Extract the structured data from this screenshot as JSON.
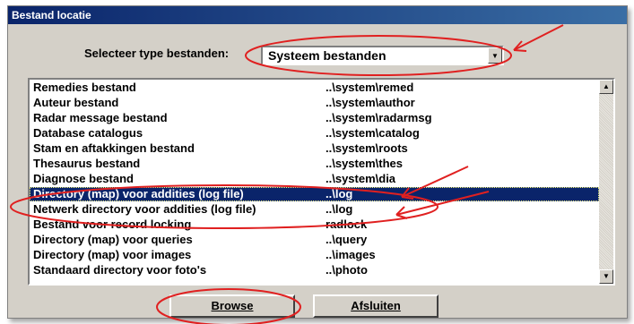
{
  "window": {
    "title": "Bestand locatie"
  },
  "filter": {
    "label": "Selecteer type bestanden:",
    "value": "Systeem bestanden"
  },
  "list": {
    "items": [
      {
        "name": "Remedies bestand",
        "path": "..\\system\\remed"
      },
      {
        "name": "Auteur bestand",
        "path": "..\\system\\author"
      },
      {
        "name": "Radar message bestand",
        "path": "..\\system\\radarmsg"
      },
      {
        "name": "Database catalogus",
        "path": "..\\system\\catalog"
      },
      {
        "name": "Stam en aftakkingen bestand",
        "path": "..\\system\\roots"
      },
      {
        "name": "Thesaurus bestand",
        "path": "..\\system\\thes"
      },
      {
        "name": "Diagnose bestand",
        "path": "..\\system\\dia"
      },
      {
        "name": "Directory (map) voor addities (log file)",
        "path": "..\\log"
      },
      {
        "name": "Netwerk directory voor addities (log file)",
        "path": "..\\log"
      },
      {
        "name": "Bestand voor record locking",
        "path": "radlock"
      },
      {
        "name": "Directory (map) voor queries",
        "path": "..\\query"
      },
      {
        "name": "Directory (map) voor images",
        "path": "..\\images"
      },
      {
        "name": "Standaard directory voor foto's",
        "path": "..\\photo"
      }
    ],
    "selected_index": 7
  },
  "buttons": {
    "browse": "Browse",
    "close": "Afsluiten"
  },
  "colors": {
    "annotation": "#e02020",
    "selection": "#0a246a"
  }
}
